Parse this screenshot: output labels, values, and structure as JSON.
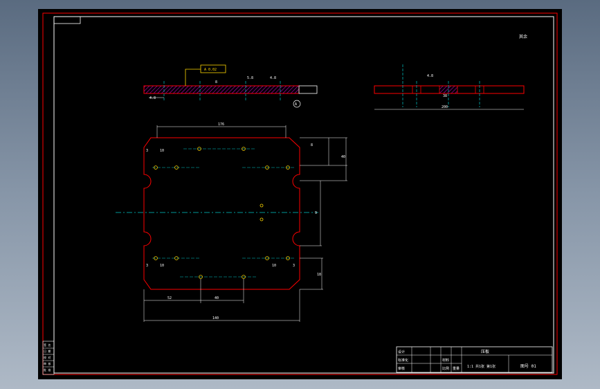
{
  "colors": {
    "background": "#000000",
    "frame": "#ff0000",
    "border_white": "#ffffff",
    "outline": "#ff0000",
    "dimension": "#ffffff",
    "centerline": "#00c8c8",
    "hatch": "#c000c0",
    "callout": "#ffd800",
    "hole": "#ffd800"
  },
  "drawing": {
    "roughness_note": "其余",
    "callout_label": "A 0.02",
    "section_label": "A"
  },
  "dims": {
    "plate_width": "176",
    "inner_width": "140",
    "top_gap": "8",
    "side_right": "40",
    "side_right2": "82",
    "mid_right": "9",
    "bottom_right": "18",
    "bottom_left_a": "52",
    "bottom_left_b": "40",
    "hole_3a": "3",
    "hole_10a": "10",
    "hole_3b": "3",
    "hole_10b": "10",
    "hole_3c": "3",
    "hole_10c": "10",
    "hole_3d": "3",
    "hole_10d": "10",
    "section_left": "4.8",
    "section_mid": "8",
    "section_r1": "5.8",
    "section_r2": "4.8",
    "side_top": "4.8",
    "side_w": "38",
    "side_total": "200"
  },
  "title_block": {
    "row1": [
      "设计",
      "",
      "",
      "工作台"
    ],
    "row2": [
      "标准化",
      "",
      "材料"
    ],
    "row3": [
      "审核",
      "",
      "比例",
      "重量"
    ],
    "name": "压板",
    "drawing_no": "1:1  共1张  第1张",
    "sheet": "图号 01"
  },
  "left_strip": [
    "签 名",
    "日 期",
    "校 对",
    "审 核",
    "批 准"
  ]
}
